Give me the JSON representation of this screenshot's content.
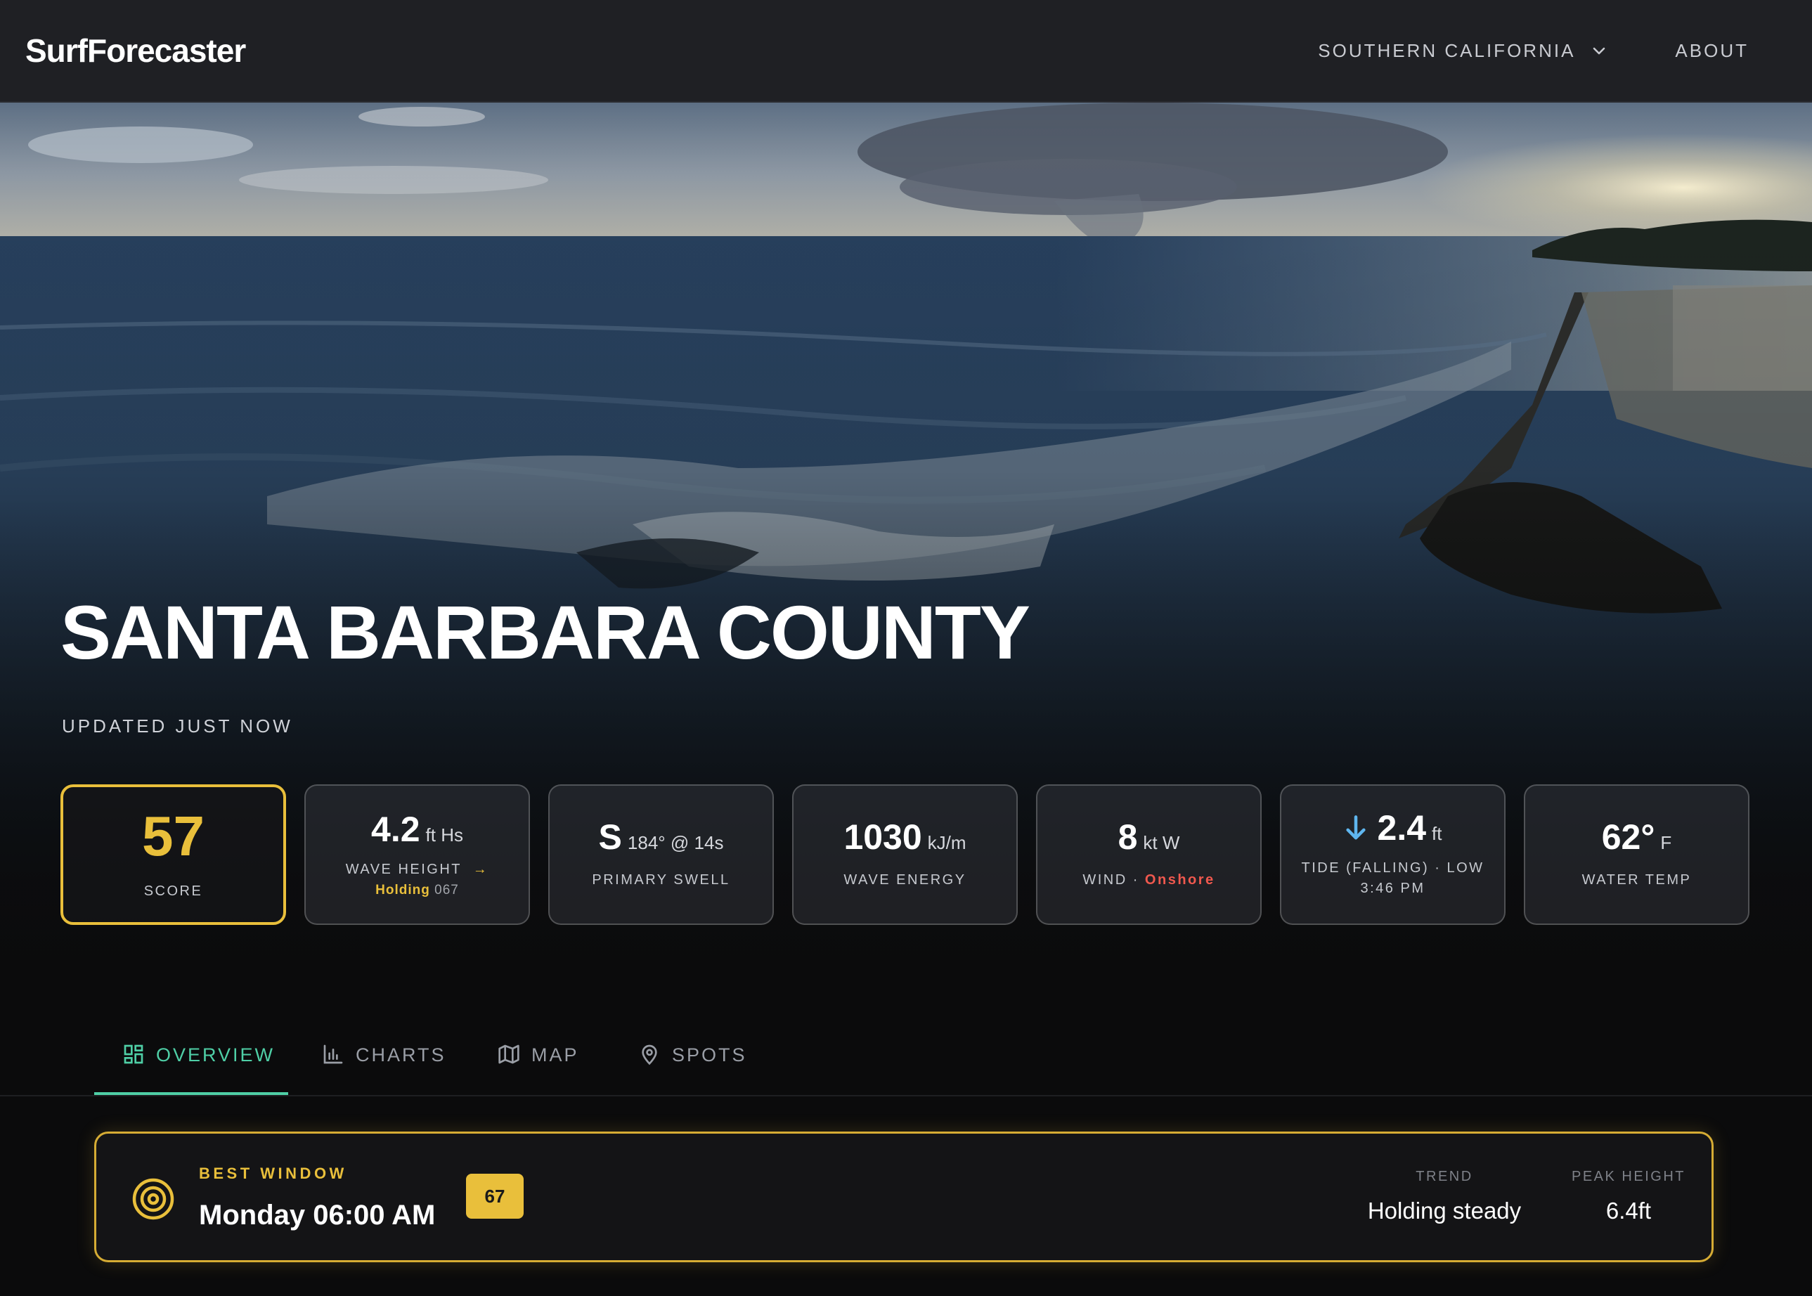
{
  "nav": {
    "brand": "SurfForecaster",
    "region": "SOUTHERN CALIFORNIA",
    "about": "ABOUT"
  },
  "hero": {
    "title": "SANTA BARBARA COUNTY",
    "updated": "UPDATED JUST NOW"
  },
  "stats": {
    "score": {
      "value": "57",
      "label": "SCORE"
    },
    "wave": {
      "value": "4.2",
      "unit": "ft Hs",
      "label": "WAVE HEIGHT",
      "trend": "Holding",
      "code": "067"
    },
    "swell": {
      "value": "S",
      "unit": "184° @ 14s",
      "label": "PRIMARY SWELL"
    },
    "energy": {
      "value": "1030",
      "unit": "kJ/m",
      "label": "WAVE ENERGY"
    },
    "wind": {
      "value": "8",
      "unit": "kt W",
      "label": "WIND ·",
      "condition": "Onshore"
    },
    "tide": {
      "value": "2.4",
      "unit": "ft",
      "label": "TIDE (FALLING) · LOW",
      "time": "3:46 PM"
    },
    "water": {
      "value": "62°",
      "unit": "F",
      "label": "WATER TEMP"
    }
  },
  "tabs": [
    {
      "label": "OVERVIEW",
      "icon": "grid-icon",
      "active": true
    },
    {
      "label": "CHARTS",
      "icon": "bar-chart-icon",
      "active": false
    },
    {
      "label": "MAP",
      "icon": "map-icon",
      "active": false
    },
    {
      "label": "SPOTS",
      "icon": "pin-icon",
      "active": false
    }
  ],
  "best_window": {
    "label": "BEST WINDOW",
    "time": "Monday 06:00 AM",
    "score": "67",
    "trend_label": "TREND",
    "trend_value": "Holding steady",
    "peak_label": "PEAK HEIGHT",
    "peak_value": "6.4ft"
  },
  "colors": {
    "accent_amber": "#e9bf3b",
    "accent_teal": "#4fcfa6",
    "alert_red": "#f0584e",
    "tide_blue": "#5fb6ef"
  }
}
